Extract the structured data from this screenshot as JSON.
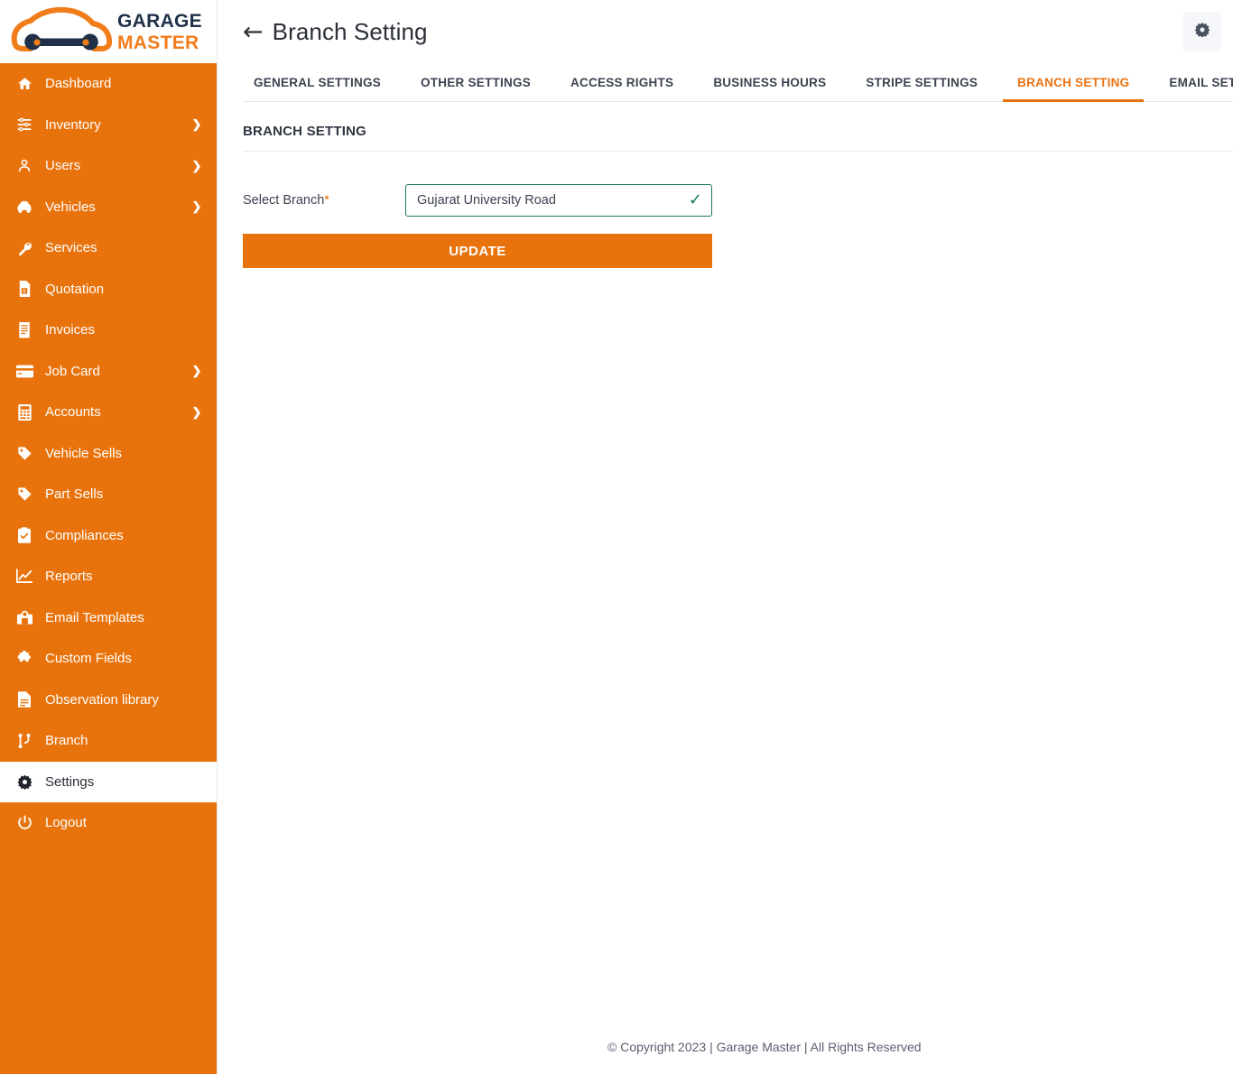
{
  "brand": {
    "logo_line1": "GARAGE",
    "logo_line2": "MASTER",
    "logo_icon": "car-wrench-logo",
    "accent_color": "#e8730c",
    "navy_color": "#1f3048"
  },
  "sidebar": {
    "items": [
      {
        "label": "Dashboard",
        "icon": "home-icon",
        "chevron": false,
        "active": false
      },
      {
        "label": "Inventory",
        "icon": "sliders-icon",
        "chevron": true,
        "active": false
      },
      {
        "label": "Users",
        "icon": "user-icon",
        "chevron": true,
        "active": false
      },
      {
        "label": "Vehicles",
        "icon": "car-icon",
        "chevron": true,
        "active": false
      },
      {
        "label": "Services",
        "icon": "wrench-icon",
        "chevron": false,
        "active": false
      },
      {
        "label": "Quotation",
        "icon": "document-money-icon",
        "chevron": false,
        "active": false
      },
      {
        "label": "Invoices",
        "icon": "receipt-icon",
        "chevron": false,
        "active": false
      },
      {
        "label": "Job Card",
        "icon": "card-icon",
        "chevron": true,
        "active": false
      },
      {
        "label": "Accounts",
        "icon": "calculator-icon",
        "chevron": true,
        "active": false
      },
      {
        "label": "Vehicle Sells",
        "icon": "tag-icon",
        "chevron": false,
        "active": false
      },
      {
        "label": "Part Sells",
        "icon": "tag-icon",
        "chevron": false,
        "active": false
      },
      {
        "label": "Compliances",
        "icon": "clipboard-check-icon",
        "chevron": false,
        "active": false
      },
      {
        "label": "Reports",
        "icon": "chart-line-icon",
        "chevron": false,
        "active": false
      },
      {
        "label": "Email Templates",
        "icon": "mail-box-icon",
        "chevron": false,
        "active": false
      },
      {
        "label": "Custom Fields",
        "icon": "puzzle-icon",
        "chevron": false,
        "active": false
      },
      {
        "label": "Observation library",
        "icon": "file-lines-icon",
        "chevron": false,
        "active": false
      },
      {
        "label": "Branch",
        "icon": "sitemap-icon",
        "chevron": false,
        "active": false
      },
      {
        "label": "Settings",
        "icon": "gear-icon",
        "chevron": false,
        "active": true
      },
      {
        "label": "Logout",
        "icon": "power-icon",
        "chevron": false,
        "active": false
      }
    ]
  },
  "topbar": {
    "back_icon": "back-arrow-icon",
    "back_arrow": "←",
    "title": "Branch Setting",
    "settings_icon": "gear-icon",
    "avatar_icon": "user-avatar-icon"
  },
  "tabs": [
    {
      "label": "GENERAL SETTINGS",
      "active": false
    },
    {
      "label": "OTHER SETTINGS",
      "active": false
    },
    {
      "label": "ACCESS RIGHTS",
      "active": false
    },
    {
      "label": "BUSINESS HOURS",
      "active": false
    },
    {
      "label": "STRIPE SETTINGS",
      "active": false
    },
    {
      "label": "BRANCH SETTING",
      "active": true
    },
    {
      "label": "EMAIL SETTING",
      "active": false
    }
  ],
  "panel": {
    "section_title": "BRANCH SETTING",
    "field_label": "Select Branch",
    "field_required_mark": "*",
    "select_value": "Gujarat University Road",
    "valid_check": "✓",
    "valid_border_color": "#1a7a4e",
    "update_label": "UPDATE"
  },
  "footer": {
    "text": "© Copyright 2023 | Garage Master | All Rights Reserved"
  }
}
